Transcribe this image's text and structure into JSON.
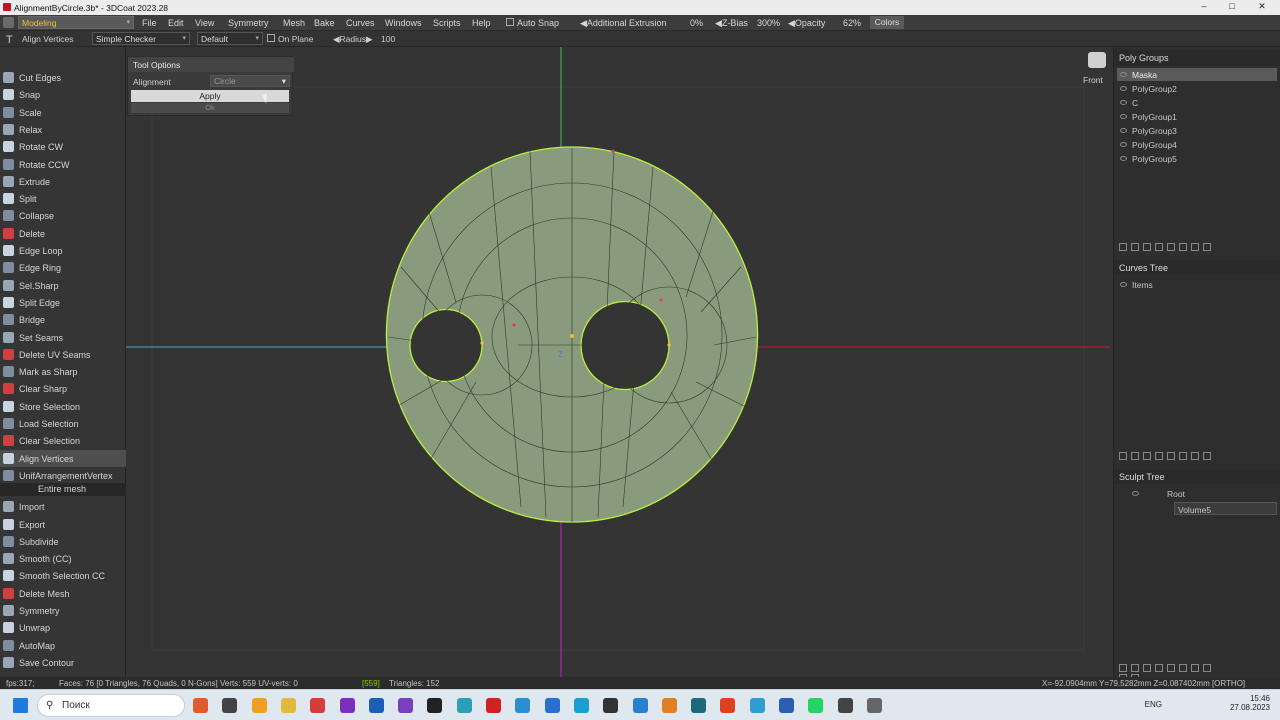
{
  "title_bar": {
    "title": "AlignmentByCircle.3b* - 3DCoat 2023.28"
  },
  "menubar": {
    "workspace": "Modeling",
    "menus": [
      "File",
      "Edit",
      "View",
      "Symmetry",
      "Mesh",
      "Bake",
      "Curves",
      "Windows",
      "Scripts",
      "Help"
    ],
    "auto_snap": "Auto Snap",
    "additional_extrusion": "Additional Extrusion",
    "extrusion_value": "0%",
    "z_bias": "Z-Bias",
    "z_bias_value": "300%",
    "opacity": "Opacity",
    "opacity_value": "62%",
    "colors": "Colors"
  },
  "toolbar2": {
    "tool_name": "Align Vertices",
    "shading": "Simple Checker",
    "preset": "Default",
    "on_plane": "On Plane",
    "radius_label": "Radius",
    "radius_value": "100"
  },
  "left_panel": {
    "tools": [
      {
        "label": "Cut Edges",
        "icon": "cut-edges-icon"
      },
      {
        "label": "Snap",
        "icon": "snap-icon"
      },
      {
        "label": "Scale",
        "icon": "scale-icon"
      },
      {
        "label": "Relax",
        "icon": "relax-icon"
      },
      {
        "label": "Rotate CW",
        "icon": "rotate-cw-icon"
      },
      {
        "label": "Rotate CCW",
        "icon": "rotate-ccw-icon"
      },
      {
        "label": "Extrude",
        "icon": "extrude-icon"
      },
      {
        "label": "Split",
        "icon": "split-icon"
      },
      {
        "label": "Collapse",
        "icon": "collapse-icon"
      },
      {
        "label": "Delete",
        "icon": "delete-icon"
      },
      {
        "label": "Edge Loop",
        "icon": "edge-loop-icon"
      },
      {
        "label": "Edge Ring",
        "icon": "edge-ring-icon"
      },
      {
        "label": "Sel.Sharp",
        "icon": "sel-sharp-icon"
      },
      {
        "label": "Split Edge",
        "icon": "split-edge-icon"
      },
      {
        "label": "Bridge",
        "icon": "bridge-icon"
      },
      {
        "label": "Set Seams",
        "icon": "set-seams-icon"
      },
      {
        "label": "Delete UV Seams",
        "icon": "delete-uv-seams-icon"
      },
      {
        "label": "Mark as Sharp",
        "icon": "mark-sharp-icon"
      },
      {
        "label": "Clear Sharp",
        "icon": "clear-sharp-icon"
      },
      {
        "label": "Store Selection",
        "icon": "store-selection-icon"
      },
      {
        "label": "Load Selection",
        "icon": "load-selection-icon"
      },
      {
        "label": "Clear Selection",
        "icon": "clear-selection-icon"
      },
      {
        "label": "Align Vertices",
        "icon": "align-vertices-icon"
      },
      {
        "label": "UnifArrangementVertex",
        "icon": "unif-arrangement-icon"
      }
    ],
    "section_header": "Entire mesh",
    "mesh_tools": [
      {
        "label": "Import",
        "icon": "import-icon"
      },
      {
        "label": "Export",
        "icon": "export-icon"
      },
      {
        "label": "Subdivide",
        "icon": "subdivide-icon"
      },
      {
        "label": "Smooth (CC)",
        "icon": "smooth-cc-icon"
      },
      {
        "label": "Smooth Selection CC",
        "icon": "smooth-selection-icon"
      },
      {
        "label": "Delete Mesh",
        "icon": "delete-mesh-icon"
      },
      {
        "label": "Symmetry",
        "icon": "symmetry-icon"
      },
      {
        "label": "Unwrap",
        "icon": "unwrap-icon"
      },
      {
        "label": "AutoMap",
        "icon": "automap-icon"
      },
      {
        "label": "Save Contour",
        "icon": "save-contour-icon"
      }
    ]
  },
  "tool_options": {
    "title": "Tool Options",
    "alignment_label": "Alignment",
    "alignment_value": "Circle",
    "apply": "Apply",
    "ok": "Ok"
  },
  "viewport": {
    "view_label": "Front",
    "axis_label": "Z"
  },
  "poly_groups": {
    "title": "Poly Groups",
    "items": [
      "Maska",
      "PolyGroup2",
      "C",
      "PolyGroup1",
      "PolyGroup3",
      "PolyGroup4",
      "PolyGroup5"
    ]
  },
  "curves_tree": {
    "title": "Curves  Tree",
    "items": [
      "Items"
    ]
  },
  "sculpt_tree": {
    "title": "Sculpt  Tree",
    "root": "Root",
    "volume": "Volume5"
  },
  "status_bar": {
    "fps": "fps:317;",
    "stats": "Faces: 76 [0 Triangles, 76 Quads, 0 N-Gons] Verts: 559   UV-verts: 0",
    "uv_count": "[559]",
    "triangles": "Triangles: 152",
    "coords": "X=-92.0904mm  Y=79.5282mm  Z=0.087402mm  [ORTHO]"
  },
  "taskbar": {
    "search_placeholder": "Поиск",
    "lang": "ENG",
    "time": "15:46",
    "date": "27.08.2023"
  },
  "colors": {
    "accent_yellow": "#f1c232",
    "mesh_fill": "#8a9a7c",
    "mesh_edge": "#b8f040"
  }
}
